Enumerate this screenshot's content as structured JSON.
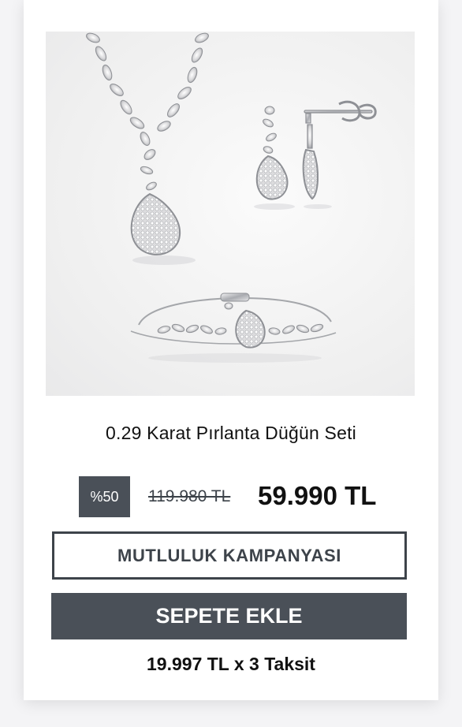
{
  "product": {
    "title": "0.29 Karat Pırlanta Düğün Seti",
    "image_subject": "jewelry-set-image"
  },
  "pricing": {
    "discount_badge": "%50",
    "old_price": "119.980 TL",
    "new_price": "59.990 TL"
  },
  "buttons": {
    "campaign_label": "MUTLULUK KAMPANYASI",
    "add_to_cart_label": "SEPETE EKLE"
  },
  "installment": {
    "text": "19.997 TL x 3 Taksit"
  },
  "colors": {
    "accent_dark": "#4a5058",
    "text": "#111111",
    "card_bg": "#ffffff"
  }
}
